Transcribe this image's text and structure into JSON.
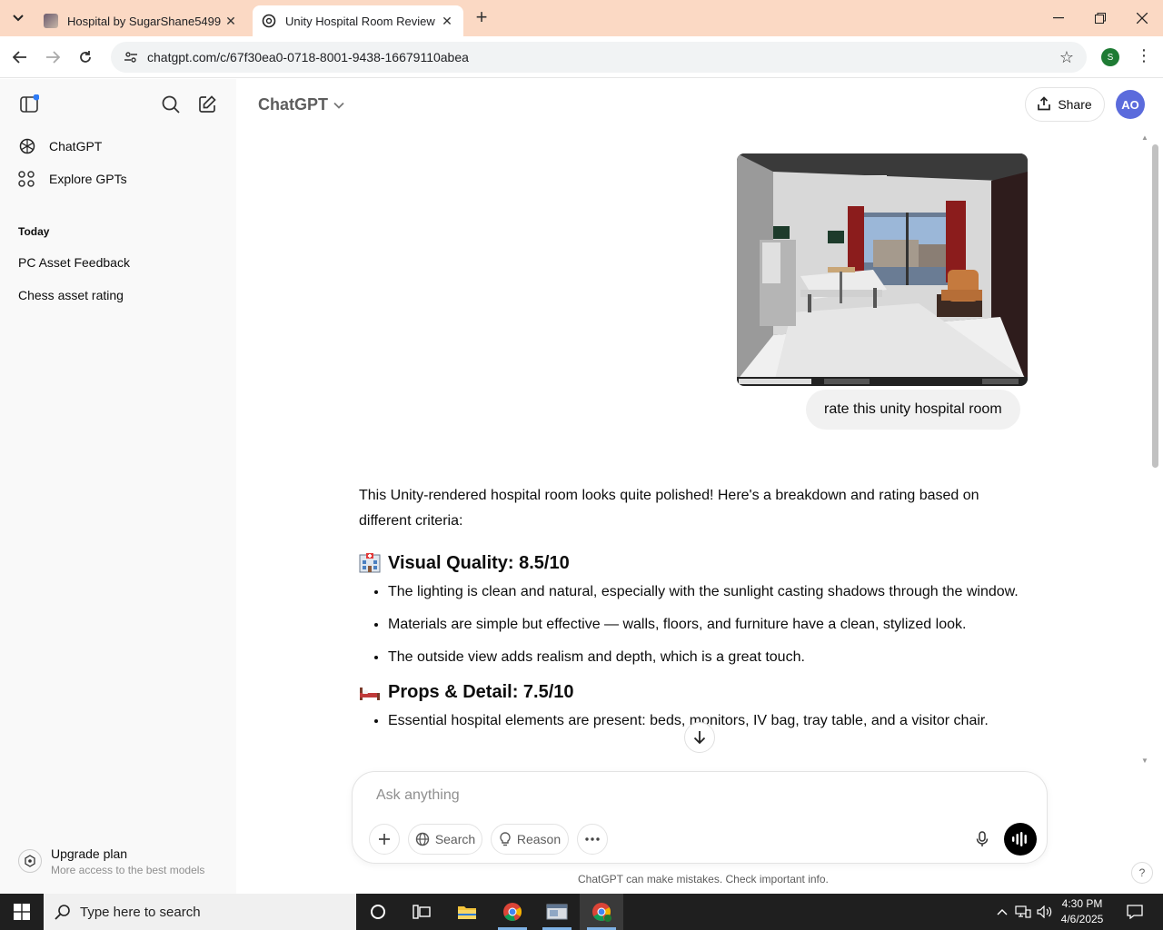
{
  "browser": {
    "tabs": [
      {
        "title": "Hospital by SugarShane5499",
        "active": false
      },
      {
        "title": "Unity Hospital Room Review",
        "active": true
      }
    ],
    "url": "chatgpt.com/c/67f30ea0-0718-8001-9438-16679110abea",
    "profile_initial": "S",
    "tab_bar_color": "#fbd9c4"
  },
  "sidebar": {
    "items": [
      {
        "label": "ChatGPT",
        "icon": "openai-logo-icon"
      },
      {
        "label": "Explore GPTs",
        "icon": "grid-icon"
      }
    ],
    "section_title": "Today",
    "chats": [
      "PC Asset Feedback",
      "Chess asset rating"
    ],
    "upgrade": {
      "title": "Upgrade plan",
      "subtitle": "More access to the best models"
    }
  },
  "header": {
    "model": "ChatGPT",
    "share_label": "Share",
    "avatar_initials": "AO",
    "avatar_color": "#5b6bdc"
  },
  "conversation": {
    "user_message": "rate this unity hospital room",
    "assistant": {
      "intro": "This Unity-rendered hospital room looks quite polished! Here's a breakdown and rating based on different criteria:",
      "sections": [
        {
          "heading": "Visual Quality: 8.5/10",
          "emoji": "hospital-icon",
          "bullets": [
            "The lighting is clean and natural, especially with the sunlight casting shadows through the window.",
            "Materials are simple but effective — walls, floors, and furniture have a clean, stylized look.",
            "The outside view adds realism and depth, which is a great touch."
          ]
        },
        {
          "heading": "Props & Detail: 7.5/10",
          "emoji": "bed-icon",
          "bullets": [
            "Essential hospital elements are present: beds, monitors, IV bag, tray table, and a visitor chair."
          ]
        }
      ]
    }
  },
  "composer": {
    "placeholder": "Ask anything",
    "search_label": "Search",
    "reason_label": "Reason",
    "disclaimer": "ChatGPT can make mistakes. Check important info.",
    "help": "?"
  },
  "taskbar": {
    "search_placeholder": "Type here to search",
    "time": "4:30 PM",
    "date": "4/6/2025"
  }
}
